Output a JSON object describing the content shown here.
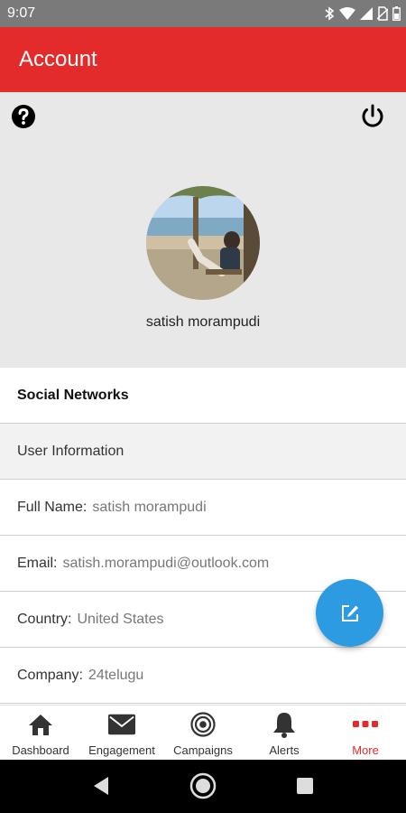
{
  "status_bar": {
    "time": "9:07",
    "icons": [
      "bluetooth-icon",
      "wifi-icon",
      "signal-icon",
      "no-sim-icon",
      "battery-icon"
    ]
  },
  "app_bar": {
    "title": "Account",
    "color": "#e32b2b"
  },
  "profile": {
    "name": "satish morampudi",
    "help_icon": "question-circle-icon",
    "power_icon": "power-icon"
  },
  "sections": {
    "social_networks": "Social Networks",
    "user_information": "User Information"
  },
  "fields": [
    {
      "label": "Full Name:",
      "value": "satish morampudi"
    },
    {
      "label": "Email:",
      "value": "satish.morampudi@outlook.com"
    },
    {
      "label": "Country:",
      "value": "United States"
    },
    {
      "label": "Company:",
      "value": "24telugu"
    }
  ],
  "fab": {
    "icon": "edit-icon",
    "color": "#2c9be2"
  },
  "bottom_nav": [
    {
      "label": "Dashboard",
      "icon": "home-icon"
    },
    {
      "label": "Engagement",
      "icon": "mail-icon"
    },
    {
      "label": "Campaigns",
      "icon": "target-icon"
    },
    {
      "label": "Alerts",
      "icon": "bell-icon"
    },
    {
      "label": "More",
      "icon": "more-dots-icon",
      "active": true
    }
  ]
}
